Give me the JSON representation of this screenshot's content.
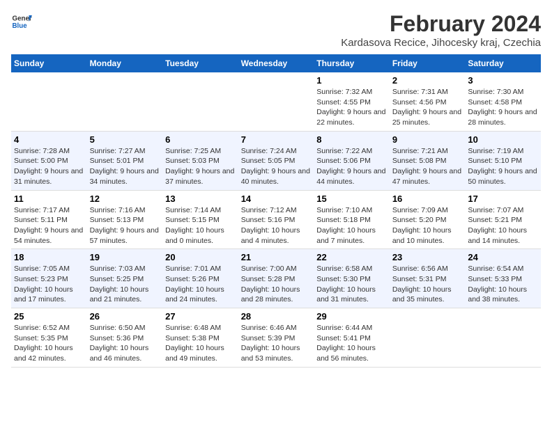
{
  "header": {
    "logo_general": "General",
    "logo_blue": "Blue",
    "title": "February 2024",
    "subtitle": "Kardasova Recice, Jihocesky kraj, Czechia"
  },
  "days_of_week": [
    "Sunday",
    "Monday",
    "Tuesday",
    "Wednesday",
    "Thursday",
    "Friday",
    "Saturday"
  ],
  "weeks": [
    [
      {
        "day": "",
        "info": ""
      },
      {
        "day": "",
        "info": ""
      },
      {
        "day": "",
        "info": ""
      },
      {
        "day": "",
        "info": ""
      },
      {
        "day": "1",
        "info": "Sunrise: 7:32 AM\nSunset: 4:55 PM\nDaylight: 9 hours and 22 minutes."
      },
      {
        "day": "2",
        "info": "Sunrise: 7:31 AM\nSunset: 4:56 PM\nDaylight: 9 hours and 25 minutes."
      },
      {
        "day": "3",
        "info": "Sunrise: 7:30 AM\nSunset: 4:58 PM\nDaylight: 9 hours and 28 minutes."
      }
    ],
    [
      {
        "day": "4",
        "info": "Sunrise: 7:28 AM\nSunset: 5:00 PM\nDaylight: 9 hours and 31 minutes."
      },
      {
        "day": "5",
        "info": "Sunrise: 7:27 AM\nSunset: 5:01 PM\nDaylight: 9 hours and 34 minutes."
      },
      {
        "day": "6",
        "info": "Sunrise: 7:25 AM\nSunset: 5:03 PM\nDaylight: 9 hours and 37 minutes."
      },
      {
        "day": "7",
        "info": "Sunrise: 7:24 AM\nSunset: 5:05 PM\nDaylight: 9 hours and 40 minutes."
      },
      {
        "day": "8",
        "info": "Sunrise: 7:22 AM\nSunset: 5:06 PM\nDaylight: 9 hours and 44 minutes."
      },
      {
        "day": "9",
        "info": "Sunrise: 7:21 AM\nSunset: 5:08 PM\nDaylight: 9 hours and 47 minutes."
      },
      {
        "day": "10",
        "info": "Sunrise: 7:19 AM\nSunset: 5:10 PM\nDaylight: 9 hours and 50 minutes."
      }
    ],
    [
      {
        "day": "11",
        "info": "Sunrise: 7:17 AM\nSunset: 5:11 PM\nDaylight: 9 hours and 54 minutes."
      },
      {
        "day": "12",
        "info": "Sunrise: 7:16 AM\nSunset: 5:13 PM\nDaylight: 9 hours and 57 minutes."
      },
      {
        "day": "13",
        "info": "Sunrise: 7:14 AM\nSunset: 5:15 PM\nDaylight: 10 hours and 0 minutes."
      },
      {
        "day": "14",
        "info": "Sunrise: 7:12 AM\nSunset: 5:16 PM\nDaylight: 10 hours and 4 minutes."
      },
      {
        "day": "15",
        "info": "Sunrise: 7:10 AM\nSunset: 5:18 PM\nDaylight: 10 hours and 7 minutes."
      },
      {
        "day": "16",
        "info": "Sunrise: 7:09 AM\nSunset: 5:20 PM\nDaylight: 10 hours and 10 minutes."
      },
      {
        "day": "17",
        "info": "Sunrise: 7:07 AM\nSunset: 5:21 PM\nDaylight: 10 hours and 14 minutes."
      }
    ],
    [
      {
        "day": "18",
        "info": "Sunrise: 7:05 AM\nSunset: 5:23 PM\nDaylight: 10 hours and 17 minutes."
      },
      {
        "day": "19",
        "info": "Sunrise: 7:03 AM\nSunset: 5:25 PM\nDaylight: 10 hours and 21 minutes."
      },
      {
        "day": "20",
        "info": "Sunrise: 7:01 AM\nSunset: 5:26 PM\nDaylight: 10 hours and 24 minutes."
      },
      {
        "day": "21",
        "info": "Sunrise: 7:00 AM\nSunset: 5:28 PM\nDaylight: 10 hours and 28 minutes."
      },
      {
        "day": "22",
        "info": "Sunrise: 6:58 AM\nSunset: 5:30 PM\nDaylight: 10 hours and 31 minutes."
      },
      {
        "day": "23",
        "info": "Sunrise: 6:56 AM\nSunset: 5:31 PM\nDaylight: 10 hours and 35 minutes."
      },
      {
        "day": "24",
        "info": "Sunrise: 6:54 AM\nSunset: 5:33 PM\nDaylight: 10 hours and 38 minutes."
      }
    ],
    [
      {
        "day": "25",
        "info": "Sunrise: 6:52 AM\nSunset: 5:35 PM\nDaylight: 10 hours and 42 minutes."
      },
      {
        "day": "26",
        "info": "Sunrise: 6:50 AM\nSunset: 5:36 PM\nDaylight: 10 hours and 46 minutes."
      },
      {
        "day": "27",
        "info": "Sunrise: 6:48 AM\nSunset: 5:38 PM\nDaylight: 10 hours and 49 minutes."
      },
      {
        "day": "28",
        "info": "Sunrise: 6:46 AM\nSunset: 5:39 PM\nDaylight: 10 hours and 53 minutes."
      },
      {
        "day": "29",
        "info": "Sunrise: 6:44 AM\nSunset: 5:41 PM\nDaylight: 10 hours and 56 minutes."
      },
      {
        "day": "",
        "info": ""
      },
      {
        "day": "",
        "info": ""
      }
    ]
  ]
}
